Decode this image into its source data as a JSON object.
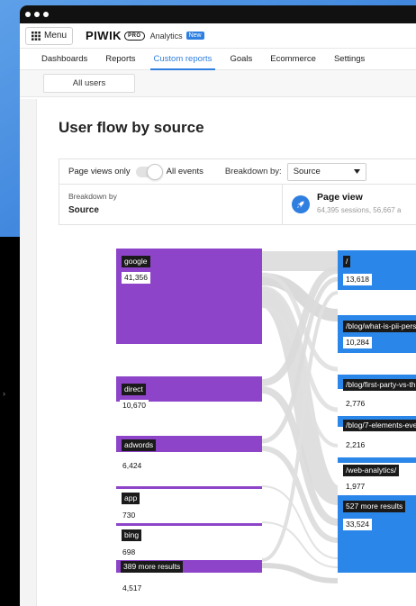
{
  "window": {
    "menu_label": "Menu",
    "brand": "PIWIK",
    "brand_badge": "PRO",
    "product": "Analytics",
    "new_badge": "New"
  },
  "nav": {
    "items": [
      "Dashboards",
      "Reports",
      "Custom reports",
      "Goals",
      "Ecommerce",
      "Settings"
    ],
    "active": "Custom reports"
  },
  "segment": {
    "label": "All users"
  },
  "report": {
    "title": "User flow by source",
    "page_views_only": "Page views only",
    "all_events": "All events",
    "breakdown_by_label": "Breakdown by:",
    "breakdown_select": "Source",
    "breakdown_small": "Breakdown by",
    "breakdown_value": "Source",
    "step_title": "Page view",
    "step_sub": "64,395 sessions, 56,667 a"
  },
  "sources": [
    {
      "name": "google",
      "value": "41,356"
    },
    {
      "name": "direct",
      "value": "10,670"
    },
    {
      "name": "adwords",
      "value": "6,424"
    },
    {
      "name": "app",
      "value": "730"
    },
    {
      "name": "bing",
      "value": "698"
    },
    {
      "name": "389 more results",
      "value": "4,517"
    }
  ],
  "pages": [
    {
      "name": "/",
      "value": "13,618"
    },
    {
      "name": "/blog/what-is-pii-pers",
      "value": "10,284"
    },
    {
      "name": "/blog/first-party-vs-th",
      "value": "2,776"
    },
    {
      "name": "/blog/7-elements-eve",
      "value": "2,216"
    },
    {
      "name": "/web-analytics/",
      "value": "1,977"
    },
    {
      "name": "527 more results",
      "value": "33,524"
    }
  ],
  "colors": {
    "source_node": "#8e44c9",
    "page_node": "#2a86e8",
    "accent": "#2f7fe0",
    "link": "#d9d9d9"
  },
  "icons": {
    "menu": "grid-icon",
    "dropdown": "chevron-down-icon",
    "step": "rocket-icon",
    "sidebar_toggle": "chevron-right-icon"
  }
}
